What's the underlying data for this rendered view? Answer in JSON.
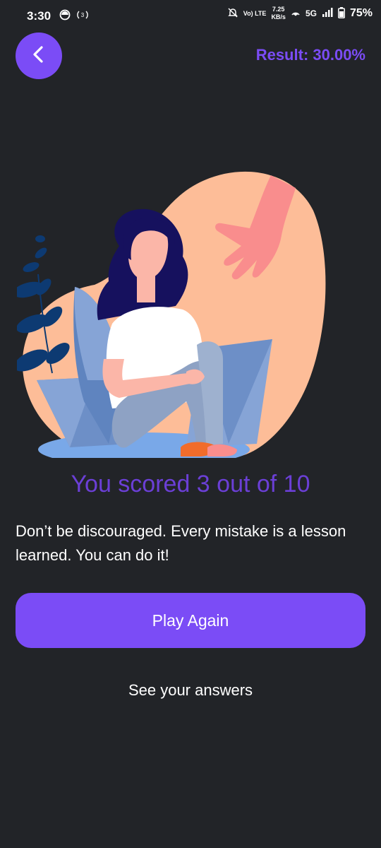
{
  "status_bar": {
    "time": "3:30",
    "speed_value": "7.25",
    "speed_unit": "KB/s",
    "network_label": "5G",
    "volte_label": "Vo) LTE",
    "battery_percent": "75%"
  },
  "header": {
    "back_icon": "chevron-left-icon",
    "result_label": "Result: 30.00%"
  },
  "result": {
    "score_text": "You scored 3 out of 10",
    "message": "Don’t be discouraged. Every mistake is a lesson learned. You can do it!"
  },
  "actions": {
    "play_again_label": "Play Again",
    "see_answers_label": "See your answers"
  },
  "colors": {
    "background": "#222428",
    "accent": "#7b4cf6",
    "score_text": "#6b3fd6",
    "blob": "#fdbd98"
  }
}
